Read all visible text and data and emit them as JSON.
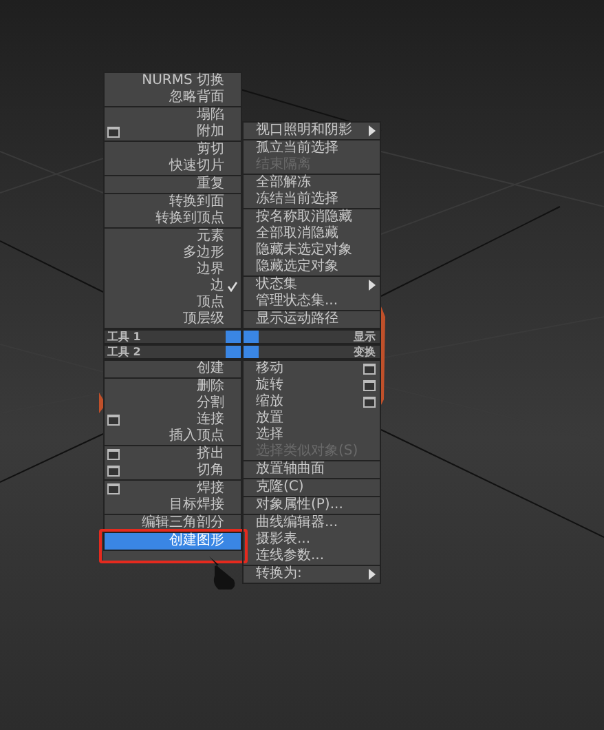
{
  "quad_menu": {
    "top_left": [
      [
        {
          "label": "NURMS 切换",
          "kind": "plain",
          "checked": false,
          "disabled": false,
          "selected": false,
          "annotated": false
        },
        {
          "label": "忽略背面",
          "kind": "plain",
          "checked": false,
          "disabled": false,
          "selected": false,
          "annotated": false
        }
      ],
      [
        {
          "label": "塌陷",
          "kind": "plain",
          "checked": false,
          "disabled": false,
          "selected": false,
          "annotated": false
        },
        {
          "label": "附加",
          "kind": "option",
          "checked": false,
          "disabled": false,
          "selected": false,
          "annotated": false
        }
      ],
      [
        {
          "label": "剪切",
          "kind": "plain",
          "checked": false,
          "disabled": false,
          "selected": false,
          "annotated": false
        },
        {
          "label": "快速切片",
          "kind": "plain",
          "checked": false,
          "disabled": false,
          "selected": false,
          "annotated": false
        }
      ],
      [
        {
          "label": "重复",
          "kind": "plain",
          "checked": false,
          "disabled": false,
          "selected": false,
          "annotated": false
        }
      ],
      [
        {
          "label": "转换到面",
          "kind": "plain",
          "checked": false,
          "disabled": false,
          "selected": false,
          "annotated": false
        },
        {
          "label": "转换到顶点",
          "kind": "plain",
          "checked": false,
          "disabled": false,
          "selected": false,
          "annotated": false
        }
      ],
      [
        {
          "label": "元素",
          "kind": "plain",
          "checked": false,
          "disabled": false,
          "selected": false,
          "annotated": false
        },
        {
          "label": "多边形",
          "kind": "plain",
          "checked": false,
          "disabled": false,
          "selected": false,
          "annotated": false
        },
        {
          "label": "边界",
          "kind": "plain",
          "checked": false,
          "disabled": false,
          "selected": false,
          "annotated": false
        },
        {
          "label": "边",
          "kind": "plain",
          "checked": true,
          "disabled": false,
          "selected": false,
          "annotated": false
        },
        {
          "label": "顶点",
          "kind": "plain",
          "checked": false,
          "disabled": false,
          "selected": false,
          "annotated": false
        },
        {
          "label": "顶层级",
          "kind": "plain",
          "checked": false,
          "disabled": false,
          "selected": false,
          "annotated": false
        }
      ]
    ],
    "top_right": [
      [
        {
          "label": "视口照明和阴影",
          "kind": "submenu",
          "checked": false,
          "disabled": false,
          "selected": false,
          "annotated": false
        }
      ],
      [
        {
          "label": "孤立当前选择",
          "kind": "plain",
          "checked": false,
          "disabled": false,
          "selected": false,
          "annotated": false
        },
        {
          "label": "结束隔离",
          "kind": "plain",
          "checked": false,
          "disabled": true,
          "selected": false,
          "annotated": false
        }
      ],
      [
        {
          "label": "全部解冻",
          "kind": "plain",
          "checked": false,
          "disabled": false,
          "selected": false,
          "annotated": false
        },
        {
          "label": "冻结当前选择",
          "kind": "plain",
          "checked": false,
          "disabled": false,
          "selected": false,
          "annotated": false
        }
      ],
      [
        {
          "label": "按名称取消隐藏",
          "kind": "plain",
          "checked": false,
          "disabled": false,
          "selected": false,
          "annotated": false
        },
        {
          "label": "全部取消隐藏",
          "kind": "plain",
          "checked": false,
          "disabled": false,
          "selected": false,
          "annotated": false
        },
        {
          "label": "隐藏未选定对象",
          "kind": "plain",
          "checked": false,
          "disabled": false,
          "selected": false,
          "annotated": false
        },
        {
          "label": "隐藏选定对象",
          "kind": "plain",
          "checked": false,
          "disabled": false,
          "selected": false,
          "annotated": false
        }
      ],
      [
        {
          "label": "状态集",
          "kind": "submenu",
          "checked": false,
          "disabled": false,
          "selected": false,
          "annotated": false
        },
        {
          "label": "管理状态集...",
          "kind": "plain",
          "checked": false,
          "disabled": false,
          "selected": false,
          "annotated": false
        }
      ],
      [
        {
          "label": "显示运动路径",
          "kind": "plain",
          "checked": false,
          "disabled": false,
          "selected": false,
          "annotated": false
        }
      ]
    ],
    "headers": [
      {
        "left": "工具 1",
        "right": "显示"
      },
      {
        "left": "工具 2",
        "right": "变换"
      }
    ],
    "bottom_left": [
      [
        {
          "label": "创建",
          "kind": "plain",
          "checked": false,
          "disabled": false,
          "selected": false,
          "annotated": false
        }
      ],
      [
        {
          "label": "删除",
          "kind": "plain",
          "checked": false,
          "disabled": false,
          "selected": false,
          "annotated": false
        },
        {
          "label": "分割",
          "kind": "plain",
          "checked": false,
          "disabled": false,
          "selected": false,
          "annotated": false
        },
        {
          "label": "连接",
          "kind": "option",
          "checked": false,
          "disabled": false,
          "selected": false,
          "annotated": false
        },
        {
          "label": "插入顶点",
          "kind": "plain",
          "checked": false,
          "disabled": false,
          "selected": false,
          "annotated": false
        }
      ],
      [
        {
          "label": "挤出",
          "kind": "option",
          "checked": false,
          "disabled": false,
          "selected": false,
          "annotated": false
        },
        {
          "label": "切角",
          "kind": "option",
          "checked": false,
          "disabled": false,
          "selected": false,
          "annotated": false
        }
      ],
      [
        {
          "label": "焊接",
          "kind": "option",
          "checked": false,
          "disabled": false,
          "selected": false,
          "annotated": false
        },
        {
          "label": "目标焊接",
          "kind": "plain",
          "checked": false,
          "disabled": false,
          "selected": false,
          "annotated": false
        }
      ],
      [
        {
          "label": "编辑三角剖分",
          "kind": "plain",
          "checked": false,
          "disabled": false,
          "selected": false,
          "annotated": false
        }
      ],
      [
        {
          "label": "创建图形",
          "kind": "plain",
          "checked": false,
          "disabled": false,
          "selected": true,
          "annotated": true
        }
      ]
    ],
    "bottom_right": [
      [
        {
          "label": "移动",
          "kind": "option",
          "checked": false,
          "disabled": false,
          "selected": false,
          "annotated": false
        },
        {
          "label": "旋转",
          "kind": "option",
          "checked": false,
          "disabled": false,
          "selected": false,
          "annotated": false
        },
        {
          "label": "缩放",
          "kind": "option",
          "checked": false,
          "disabled": false,
          "selected": false,
          "annotated": false
        },
        {
          "label": "放置",
          "kind": "plain",
          "checked": false,
          "disabled": false,
          "selected": false,
          "annotated": false
        },
        {
          "label": "选择",
          "kind": "plain",
          "checked": false,
          "disabled": false,
          "selected": false,
          "annotated": false
        },
        {
          "label": "选择类似对象(S)",
          "kind": "plain",
          "checked": false,
          "disabled": true,
          "selected": false,
          "annotated": false
        }
      ],
      [
        {
          "label": "放置轴曲面",
          "kind": "plain",
          "checked": false,
          "disabled": false,
          "selected": false,
          "annotated": false
        }
      ],
      [
        {
          "label": "克隆(C)",
          "kind": "plain",
          "checked": false,
          "disabled": false,
          "selected": false,
          "annotated": false
        }
      ],
      [
        {
          "label": "对象属性(P)...",
          "kind": "plain",
          "checked": false,
          "disabled": false,
          "selected": false,
          "annotated": false
        }
      ],
      [
        {
          "label": "曲线编辑器...",
          "kind": "plain",
          "checked": false,
          "disabled": false,
          "selected": false,
          "annotated": false
        },
        {
          "label": "摄影表...",
          "kind": "plain",
          "checked": false,
          "disabled": false,
          "selected": false,
          "annotated": false
        },
        {
          "label": "连线参数...",
          "kind": "plain",
          "checked": false,
          "disabled": false,
          "selected": false,
          "annotated": false
        }
      ],
      [
        {
          "label": "转换为:",
          "kind": "submenu",
          "checked": false,
          "disabled": false,
          "selected": false,
          "annotated": false
        }
      ]
    ]
  }
}
